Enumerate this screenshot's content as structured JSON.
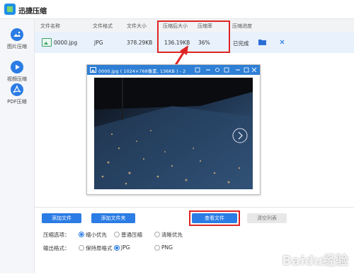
{
  "app": {
    "title": "迅捷压缩"
  },
  "sidebar": {
    "items": [
      {
        "label": "图片压缩",
        "icon": "image-icon"
      },
      {
        "label": "视频压缩",
        "icon": "video-icon"
      },
      {
        "label": "PDF压缩",
        "icon": "pdf-icon"
      }
    ]
  },
  "table": {
    "headers": [
      "文件名称",
      "文件格式",
      "文件大小",
      "压缩后大小",
      "压缩率",
      "压缩进度"
    ],
    "rows": [
      {
        "name": "0000.jpg",
        "format": "JPG",
        "size": "378.29KB",
        "compressed_size": "136.19KB",
        "ratio": "36%",
        "status": "已完成"
      }
    ]
  },
  "preview": {
    "title": "0000.jpg ( 1024×768像素, 136KB ) - 2"
  },
  "controls": {
    "add_file": "添加文件",
    "add_folder": "添加文件夹",
    "view_files": "查看文件",
    "clear_list": "清空列表",
    "compress_label": "压缩选项：",
    "compress_options": [
      "缩小优先",
      "普通压缩",
      "清晰优先"
    ],
    "output_label": "输出格式：",
    "output_options": [
      "保持原格式",
      "JPG",
      "PNG"
    ]
  },
  "watermark": "Baidu经验",
  "colors": {
    "accent": "#2b7ce4",
    "highlight": "#e02424"
  }
}
